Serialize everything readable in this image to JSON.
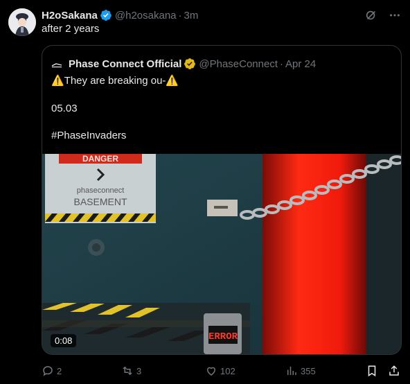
{
  "tweet": {
    "author_name": "H2oSakana",
    "author_handle": "@h2osakana",
    "separator": "·",
    "time": "3m",
    "text": "after 2 years"
  },
  "quoted": {
    "author_name": "Phase Connect Official",
    "author_handle": "@PhaseConnect",
    "separator": "·",
    "date": "Apr 24",
    "line1": "⚠️They are breaking ou-⚠️",
    "line2": "05.03",
    "line3": "#PhaseInvaders",
    "video_duration": "0:08",
    "video_signs": {
      "danger": "DANGER",
      "company": "phaseconnect",
      "basement": "BASEMENT",
      "error": "ERROR"
    }
  },
  "actions": {
    "replies": "2",
    "reposts": "3",
    "likes": "102",
    "views": "355"
  },
  "colors": {
    "background": "#000000",
    "text": "#e7e9ea",
    "muted": "#71767b",
    "verified_blue": "#1d9bf0",
    "verified_gold": "#e2b719"
  }
}
